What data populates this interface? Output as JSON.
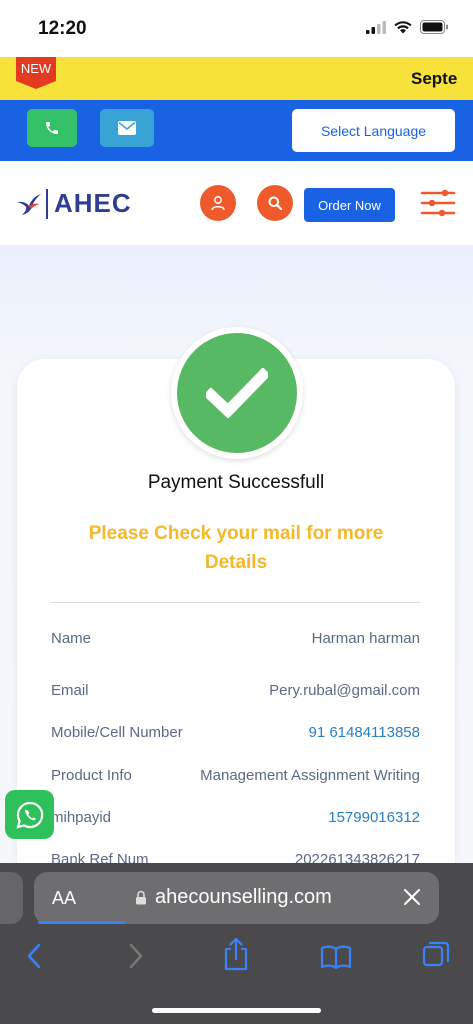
{
  "status_bar": {
    "time": "12:20"
  },
  "ticker": {
    "badge": "NEW",
    "text": "Septe"
  },
  "contact_bar": {
    "language_label": "Select Language"
  },
  "header": {
    "logo_text": "AHEC",
    "order_label": "Order Now"
  },
  "payment": {
    "title": "Payment Successfull",
    "subtitle": "Please Check your mail for more Details",
    "rows": [
      {
        "label": "Name",
        "value": "Harman harman"
      },
      {
        "label": "Email",
        "value": "Pery.rubal@gmail.com"
      },
      {
        "label": "Mobile/Cell Number",
        "value": "91 61484113858"
      },
      {
        "label": "Product Info",
        "value": "Management Assignment Writing"
      },
      {
        "label": "mihpayid",
        "value": "15799016312"
      },
      {
        "label": "Bank Ref Num",
        "value": "202261343826217"
      }
    ]
  },
  "browser": {
    "aa_label": "AA",
    "url": "ahecounselling.com"
  },
  "colors": {
    "brand_blue": "#1a62e4",
    "accent_orange": "#ef5a2d",
    "success_green": "#57b963",
    "highlight_yellow": "#f5b82a"
  }
}
